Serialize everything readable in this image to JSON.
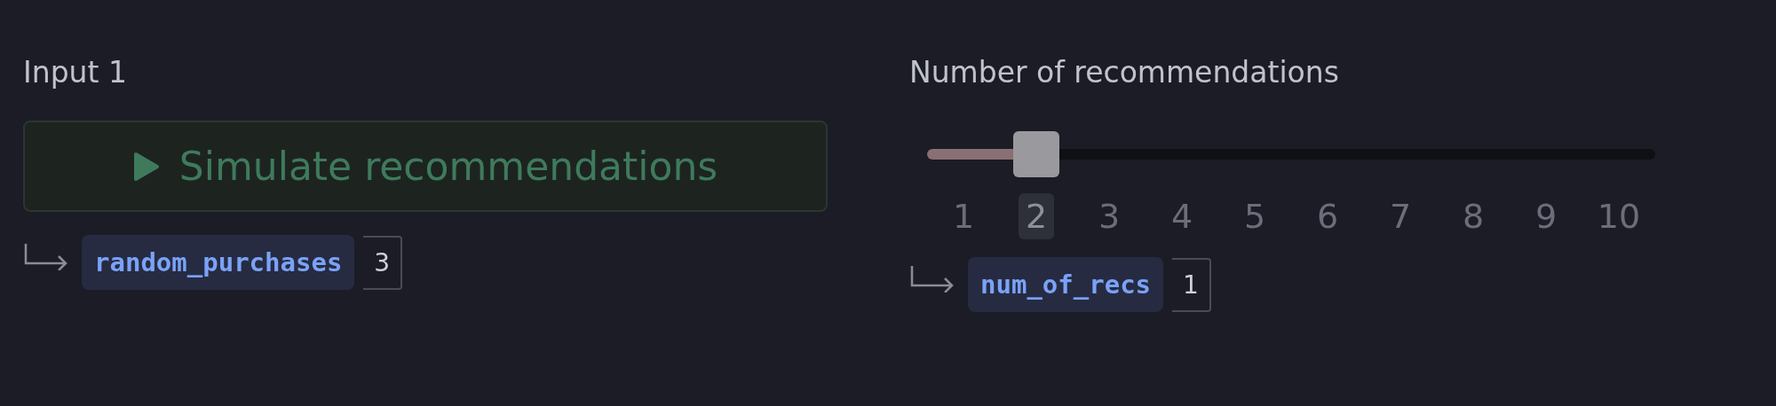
{
  "input_panel": {
    "label": "Input 1",
    "button": {
      "label": "Simulate recommendations",
      "disabled": true
    },
    "output": {
      "variable": "random_purchases",
      "value": "3"
    }
  },
  "slider_panel": {
    "label": "Number of recommendations",
    "slider": {
      "level": 0.111
    },
    "ticks": [
      {
        "label": "1",
        "selected": false
      },
      {
        "label": "2",
        "selected": true
      },
      {
        "label": "3",
        "selected": false
      },
      {
        "label": "4",
        "selected": false
      },
      {
        "label": "5",
        "selected": false
      },
      {
        "label": "6",
        "selected": false
      },
      {
        "label": "7",
        "selected": false
      },
      {
        "label": "8",
        "selected": false
      },
      {
        "label": "9",
        "selected": false
      },
      {
        "label": "10",
        "selected": false
      }
    ],
    "output": {
      "variable": "num_of_recs",
      "value": "1"
    }
  }
}
